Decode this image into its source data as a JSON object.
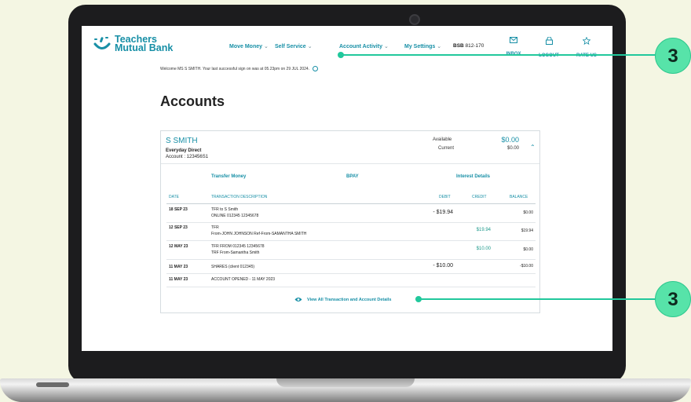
{
  "brand": {
    "line1": "Teachers",
    "line2": "Mutual Bank",
    "accent": "#178fa6",
    "callout_color": "#57e3a9"
  },
  "nav": {
    "items": [
      {
        "label": "Move Money"
      },
      {
        "label": "Self Service"
      },
      {
        "label": "Account Activity"
      },
      {
        "label": "My Settings"
      }
    ],
    "bsb_label": "BSB",
    "bsb_value": "812-170",
    "icons": [
      {
        "label": "INBOX",
        "icon": "envelope-icon"
      },
      {
        "label": "LOGOUT",
        "icon": "lock-icon"
      },
      {
        "label": "RATE US",
        "icon": "star-icon"
      }
    ]
  },
  "welcome": "Welcome MS S SMITH. Your last successful sign on was at 05.23pm on 29 JUL 2024.",
  "page_title": "Accounts",
  "account": {
    "name": "S SMITH",
    "type": "Everyday Direct",
    "number": "Account : 123456S1",
    "available_label": "Available",
    "available_value": "$0.00",
    "current_label": "Current",
    "current_value": "$0.00"
  },
  "actions": [
    "Transfer Money",
    "BPAY",
    "Interest Details"
  ],
  "table": {
    "headers": {
      "date": "DATE",
      "desc": "TRANSACTION DESCRIPTION",
      "debit": "DEBIT",
      "credit": "CREDIT",
      "balance": "BALANCE"
    },
    "rows": [
      {
        "date": "18 SEP 23",
        "desc1": "TFR to S Smith",
        "desc2": "ONLINE 012345 12345678",
        "debit": "- $19.94",
        "credit": "",
        "balance": "$0.00"
      },
      {
        "date": "12 SEP 23",
        "desc1": "TFR",
        "desc2": "From-JOHN JOHNSON Ref-From-SAMANTHA SMITH",
        "debit": "",
        "credit": "$19.94",
        "balance": "$19.94"
      },
      {
        "date": "12 MAY 23",
        "desc1": "TFR FROM 012345 12345678",
        "desc2": "TRF From-Samantha Smith",
        "debit": "",
        "credit": "$10.00",
        "balance": "$0.00"
      },
      {
        "date": "11 MAY 23",
        "desc1": "SHARES (client 012345)",
        "desc2": "",
        "debit": "- $10.00",
        "credit": "",
        "balance": "-$10.00"
      },
      {
        "date": "11 MAY 23",
        "desc1": "ACCOUNT OPENED - 11 MAY 2023",
        "desc2": "",
        "debit": "",
        "credit": "",
        "balance": ""
      }
    ]
  },
  "view_all": "View All Transaction and Account Details",
  "callouts": [
    "3",
    "3"
  ]
}
